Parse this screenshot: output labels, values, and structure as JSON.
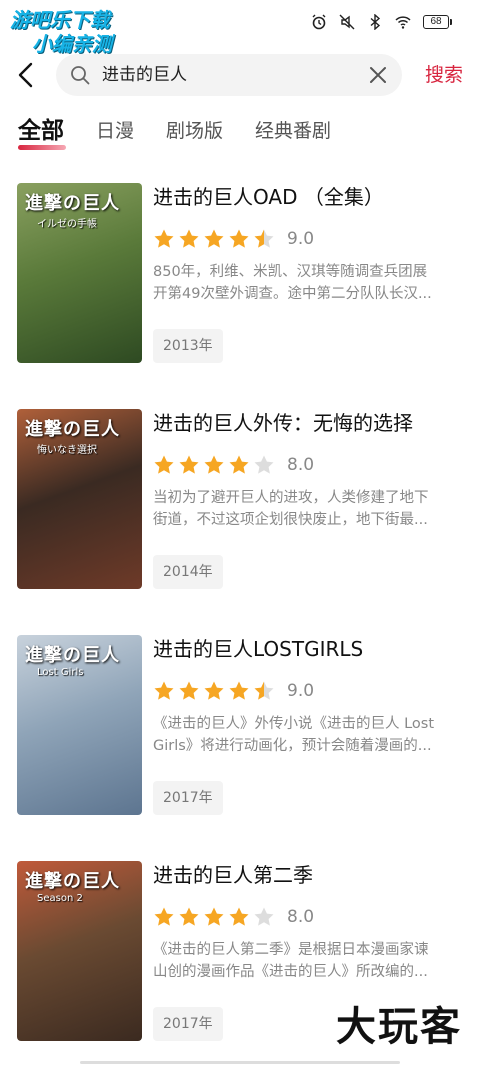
{
  "status_bar": {
    "watermark_line1": "游吧乐下载",
    "watermark_line2": "小编亲测",
    "battery": "68",
    "icons": [
      "alarm-icon",
      "mute-icon",
      "bluetooth-icon",
      "wifi-icon",
      "battery-icon"
    ]
  },
  "search": {
    "query": "进击的巨人",
    "submit_label": "搜索",
    "back_icon": "back-arrow-icon",
    "search_icon": "search-icon",
    "clear_icon": "clear-icon"
  },
  "tabs": [
    {
      "label": "全部",
      "active": true
    },
    {
      "label": "日漫",
      "active": false
    },
    {
      "label": "剧场版",
      "active": false
    },
    {
      "label": "经典番剧",
      "active": false
    }
  ],
  "results": [
    {
      "title": "进击的巨人OAD （全集）",
      "stars": 4.5,
      "score": "9.0",
      "desc_line1": "850年，利维、米凯、汉琪等随调查兵团展",
      "desc_line2": "开第49次壁外调查。途中第二分队队长汉...",
      "year": "2013年",
      "poster_logo": "進撃の巨人",
      "poster_sub": "イルゼの手帳",
      "poster_colors": [
        "#5a7a3a",
        "#2e4a22",
        "#8aa060"
      ]
    },
    {
      "title": "进击的巨人外传：无悔的选择",
      "stars": 4,
      "score": "8.0",
      "desc_line1": "当初为了避开巨人的进攻，人类修建了地下",
      "desc_line2": "街道，不过这项企划很快废止，地下街最...",
      "year": "2014年",
      "poster_logo": "進撃の巨人",
      "poster_sub": "悔いなき選択",
      "poster_colors": [
        "#3a2a22",
        "#6e3a28",
        "#b0603a"
      ]
    },
    {
      "title": "进击的巨人LOSTGIRLS",
      "stars": 4.5,
      "score": "9.0",
      "desc_line1": "《进击的巨人》外传小说《进击的巨人 Lost",
      "desc_line2": "Girls》将进行动画化，预计会随着漫画的...",
      "year": "2017年",
      "poster_logo": "進撃の巨人",
      "poster_sub": "Lost Girls",
      "poster_colors": [
        "#8fa4b8",
        "#5d7590",
        "#c8d2dc"
      ]
    },
    {
      "title": "进击的巨人第二季",
      "stars": 4,
      "score": "8.0",
      "desc_line1": "《进击的巨人第二季》是根据日本漫画家谏",
      "desc_line2": "山创的漫画作品《进击的巨人》所改编的...",
      "year": "2017年",
      "poster_logo": "進撃の巨人",
      "poster_sub": "Season 2",
      "poster_colors": [
        "#6a4a32",
        "#3b2a20",
        "#c05a3a"
      ]
    }
  ],
  "watermark_bottom": "大玩客",
  "colors": {
    "accent": "#d8253f",
    "star": "#f6a623",
    "star_empty": "#dddddd"
  }
}
